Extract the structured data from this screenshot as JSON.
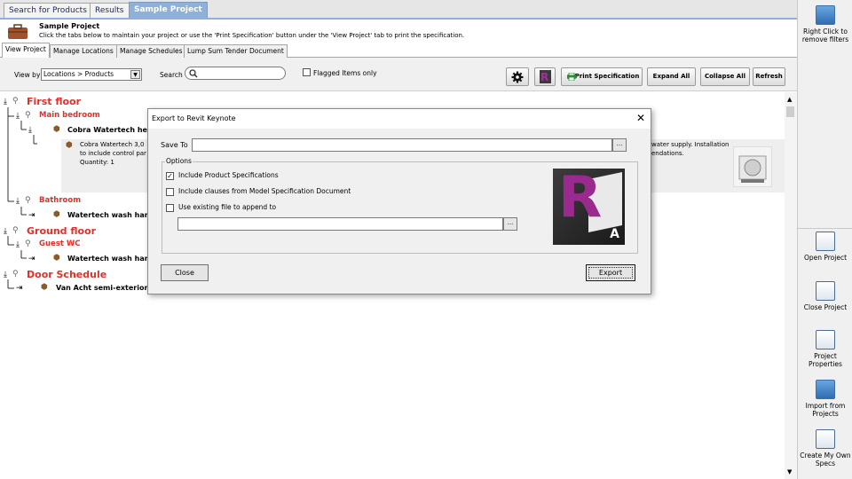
{
  "top_tabs": [
    "Search for Products",
    "Results",
    "Sample Project"
  ],
  "header": {
    "title": "Sample Project",
    "description": "Click the tabs below to maintain your project or use the 'Print Specification' button under the 'View Project' tab to print the specification."
  },
  "sub_tabs": [
    "View Project",
    "Manage Locations",
    "Manage Schedules",
    "Lump Sum Tender Document"
  ],
  "toolbar": {
    "view_by_label": "View by",
    "view_by_value": "Locations > Products",
    "search_label": "Search",
    "flagged_label": "Flagged Items only",
    "print_label": "Print Specification",
    "expand_label": "Expand All",
    "collapse_label": "Collapse All",
    "refresh_label": "Refresh"
  },
  "tree": {
    "first_floor": "First floor",
    "main_bedroom": "Main bedroom",
    "cobra_short": "Cobra Watertech heat",
    "cobra_detail_line1": "Cobra Watertech 3,0",
    "cobra_detail_line2": "to include control par",
    "cobra_quantity": "Quantity: 1",
    "detail_right_line1": "water supply. Installation",
    "detail_right_line2": "endations.",
    "bathroom": "Bathroom",
    "wash_hand_1": "Watertech wash hand",
    "ground_floor": "Ground floor",
    "guest_wc": "Guest WC",
    "wash_hand_2": "Watertech wash hand",
    "door_schedule": "Door Schedule",
    "van_acht": "Van Acht semi-exterior d"
  },
  "right_panel": {
    "remove_filters": "Right Click to remove filters",
    "open_project": "Open Project",
    "close_project": "Close Project",
    "project_properties": "Project Properties",
    "import_projects": "Import from Projects",
    "create_specs": "Create My Own Specs"
  },
  "dialog": {
    "title": "Export to Revit Keynote",
    "save_to_label": "Save To",
    "save_to_value": "",
    "options_legend": "Options",
    "opt_product_specs": "Include Product Specifications",
    "opt_product_specs_checked": true,
    "opt_clauses": "Include clauses from Model Specification Document",
    "opt_clauses_checked": false,
    "opt_existing": "Use existing file to append to",
    "opt_existing_checked": false,
    "browse_label": "...",
    "close_label": "Close",
    "export_label": "Export",
    "logo_letter": "A"
  }
}
